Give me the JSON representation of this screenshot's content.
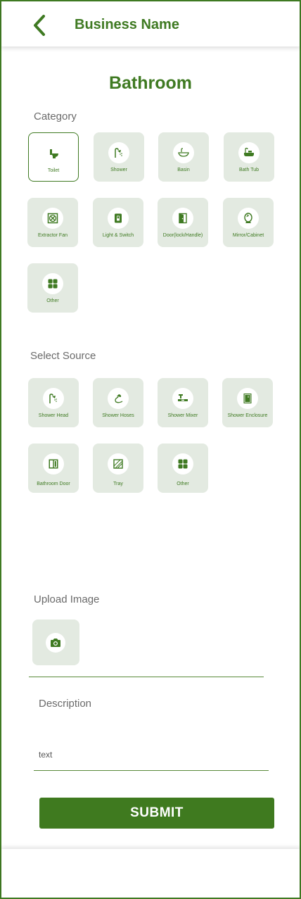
{
  "header": {
    "title": "Business Name",
    "back_icon": "chevron-left-icon"
  },
  "page": {
    "title": "Bathroom"
  },
  "category": {
    "label": "Category",
    "selected": "Toilet",
    "items": [
      {
        "label": "Toilet",
        "icon": "toilet-icon"
      },
      {
        "label": "Shower",
        "icon": "shower-icon"
      },
      {
        "label": "Basin",
        "icon": "basin-icon"
      },
      {
        "label": "Bath Tub",
        "icon": "bathtub-icon"
      },
      {
        "label": "Extractor Fan",
        "icon": "extractor-fan-icon"
      },
      {
        "label": "Light & Switch",
        "icon": "light-switch-icon"
      },
      {
        "label": "Door(lock/Handle)",
        "icon": "door-icon"
      },
      {
        "label": "Mirror/Cabinet",
        "icon": "mirror-icon"
      },
      {
        "label": "Other",
        "icon": "grid-icon"
      }
    ]
  },
  "source": {
    "label": "Select Source",
    "items": [
      {
        "label": "Shower Head",
        "icon": "shower-head-icon"
      },
      {
        "label": "Shower Hoses",
        "icon": "shower-hose-icon"
      },
      {
        "label": "Shower Mixer",
        "icon": "shower-mixer-icon"
      },
      {
        "label": "Shower Enclosure",
        "icon": "shower-enclosure-icon"
      },
      {
        "label": "Bathroom Door",
        "icon": "bathroom-door-icon"
      },
      {
        "label": "Tray",
        "icon": "tray-icon"
      },
      {
        "label": "Other",
        "icon": "grid-icon"
      }
    ]
  },
  "upload": {
    "label": "Upload Image",
    "icon": "camera-icon"
  },
  "description": {
    "label": "Description",
    "placeholder": "text"
  },
  "submit": {
    "label": "SUBMIT"
  },
  "colors": {
    "brand": "#3f7a22",
    "tile_bg": "#e3eae1",
    "label_gray": "#6a6a6a"
  }
}
